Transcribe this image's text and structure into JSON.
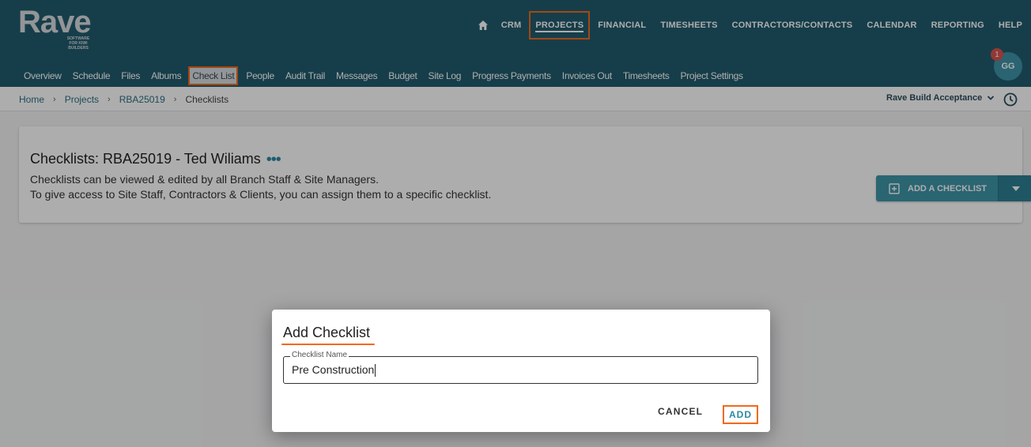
{
  "brand": {
    "name": "Rave",
    "tagline": "SOFTWARE FOR KIWI BUILDERS"
  },
  "topnav": {
    "items": [
      "CRM",
      "PROJECTS",
      "FINANCIAL",
      "TIMESHEETS",
      "CONTRACTORS/CONTACTS",
      "CALENDAR",
      "REPORTING",
      "HELP"
    ],
    "active": "PROJECTS"
  },
  "subnav": {
    "items": [
      "Overview",
      "Schedule",
      "Files",
      "Albums",
      "Check List",
      "People",
      "Audit Trail",
      "Messages",
      "Budget",
      "Site Log",
      "Progress Payments",
      "Invoices Out",
      "Timesheets",
      "Project Settings"
    ],
    "active": "Check List"
  },
  "user": {
    "initials": "GG",
    "notifications": "1"
  },
  "breadcrumb": {
    "home": "Home",
    "projects": "Projects",
    "project": "RBA25019",
    "current": "Checklists",
    "separator": "›"
  },
  "branch": {
    "selected": "Rave Build Acceptance"
  },
  "card": {
    "title": "Checklists: RBA25019 - Ted Wiliams",
    "more": "•••",
    "line1": "Checklists can be viewed & edited by all Branch Staff & Site Managers.",
    "line2": "To give access to Site Staff, Contractors & Clients, you can assign them to a specific checklist.",
    "add_button": "ADD A CHECKLIST"
  },
  "dialog": {
    "title": "Add Checklist",
    "field_label": "Checklist Name",
    "field_value": "Pre Construction",
    "cancel": "CANCEL",
    "add": "ADD"
  },
  "colors": {
    "header": "#215c6e",
    "accent": "#3f95a8",
    "highlight": "#f26a1b"
  }
}
